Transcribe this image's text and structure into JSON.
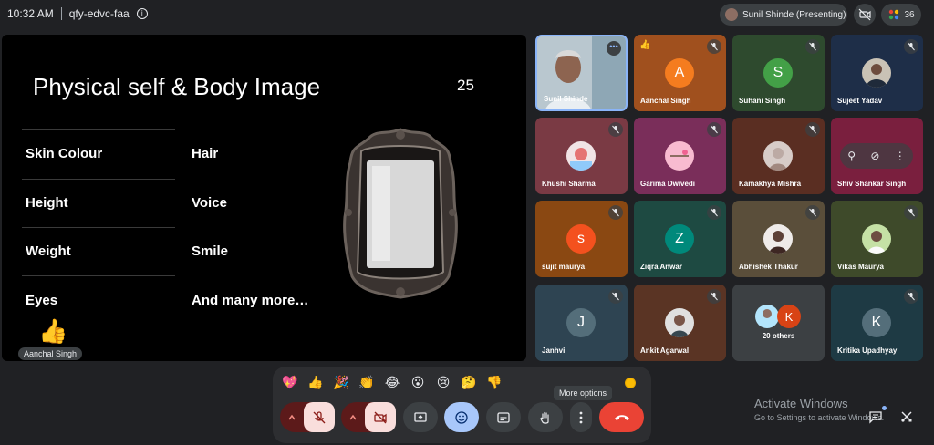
{
  "topbar": {
    "time": "10:32 AM",
    "meeting_code": "qfy-edvc-faa",
    "presenter_label": "Sunil Shinde (Presenting)",
    "participant_count": "36"
  },
  "slide": {
    "title": "Physical self & Body Image",
    "number": "25",
    "left_items": [
      "Skin Colour",
      "Height",
      "Weight",
      "Eyes"
    ],
    "right_items": [
      "Hair",
      "Voice",
      "Smile",
      "And many more…"
    ]
  },
  "reaction": {
    "emoji": "👍",
    "name": "Aanchal Singh"
  },
  "tiles": [
    {
      "name": "Sunil Shinde"
    },
    {
      "name": "Aanchal Singh",
      "initial": "A"
    },
    {
      "name": "Suhani Singh",
      "initial": "S"
    },
    {
      "name": "Sujeet Yadav"
    },
    {
      "name": "Khushi Sharma"
    },
    {
      "name": "Garima Dwivedi"
    },
    {
      "name": "Kamakhya Mishra"
    },
    {
      "name": "Shiv Shankar Singh"
    },
    {
      "name": "sujit maurya",
      "initial": "s"
    },
    {
      "name": "Ziqra Anwar",
      "initial": "Z"
    },
    {
      "name": "Abhishek Thakur"
    },
    {
      "name": "Vikas Maurya"
    },
    {
      "name": "Janhvi",
      "initial": "J"
    },
    {
      "name": "Ankit Agarwal"
    },
    {
      "name": "20 others",
      "initial": "K"
    },
    {
      "name": "Kritika Upadhyay",
      "initial": "K"
    }
  ],
  "emojis": [
    "💖",
    "👍",
    "🎉",
    "👏",
    "😂",
    "😮",
    "😢",
    "🤔",
    "👎"
  ],
  "controls": {
    "tooltip": "More options"
  },
  "windows": {
    "title": "Activate Windows",
    "subtitle": "Go to Settings to activate Windows."
  },
  "colors": {
    "tile_orange": "#a0501e",
    "tile_green": "#2e4a2e",
    "tile_navy": "#1e2e48",
    "tile_rose": "#7a3a44",
    "end_call": "#ea4335",
    "accent_blue": "#8ab4f8"
  }
}
